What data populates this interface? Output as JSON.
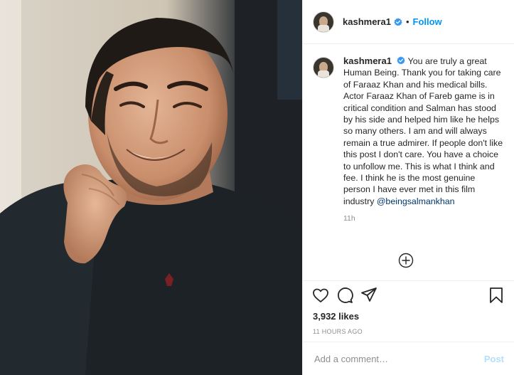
{
  "post": {
    "username": "kashmera1",
    "follow_label": "Follow",
    "separator": "•",
    "caption_text": "You are truly a great Human Being. Thank you for taking care of Faraaz Khan and his medical bills. Actor Faraaz Khan of Fareb game is in critical condition and Salman has stood by his side and helped him like he helps so many others. I am and will always remain a true admirer. If people don't like this post I don't care. You have a choice to unfollow me. This is what I think and fee. I think he is the most genuine person I have ever met in this film industry",
    "caption_mention": "@beingsalmankhan",
    "caption_time": "11h",
    "likes": "3,932 likes",
    "posted_ago": "11 HOURS AGO",
    "comment_placeholder": "Add a comment…",
    "post_label": "Post"
  },
  "icons": {
    "verified": "verified-badge-icon",
    "like": "heart-icon",
    "comment": "comment-bubble-icon",
    "share": "paper-plane-icon",
    "save": "bookmark-icon",
    "more": "plus-circle-icon"
  },
  "colors": {
    "accent": "#0095f6",
    "post_button_disabled": "#b2dffc",
    "muted_text": "#8e8e8e",
    "mention": "#00376b"
  }
}
